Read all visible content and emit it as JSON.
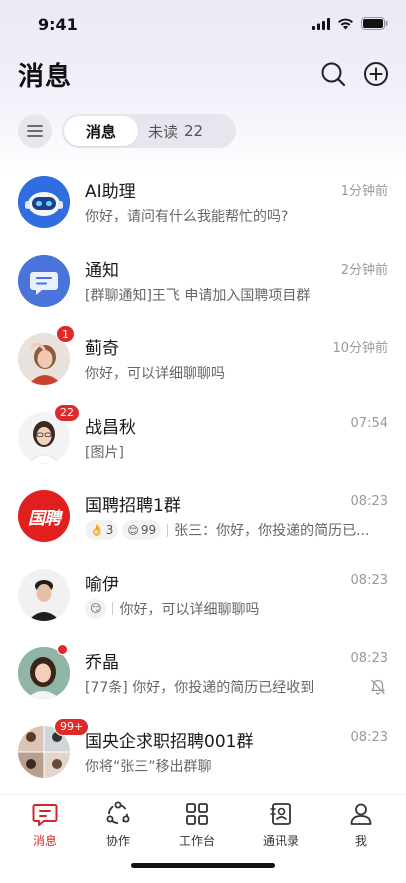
{
  "status": {
    "time": "9:41"
  },
  "header": {
    "title": "消息",
    "search_icon": "search-icon",
    "add_icon": "plus-circle-icon"
  },
  "tabs": {
    "active": "消息",
    "other_label": "未读",
    "other_count": "22"
  },
  "conversations": [
    {
      "name": "AI助理",
      "time": "1分钟前",
      "preview": "你好，请问有什么我能帮忙的吗?",
      "avatar": "robot-avatar"
    },
    {
      "name": "通知",
      "time": "2分钟前",
      "preview": "[群聊通知]王飞 申请加入国聘项目群",
      "avatar": "notification-avatar"
    },
    {
      "name": "蓟奇",
      "time": "10分钟前",
      "preview": "你好，可以详细聊聊吗",
      "badge": "1",
      "avatar": "person-avatar"
    },
    {
      "name": "战昌秋",
      "time": "07:54",
      "preview": "[图片]",
      "badge": "22",
      "avatar": "person-avatar"
    },
    {
      "name": "国聘招聘1群",
      "time": "08:23",
      "reaction1": "3",
      "reaction2": "99",
      "preview": "张三：你好，你投递的简历已...",
      "avatar": "guopin-logo-avatar",
      "logo_text": "国聘"
    },
    {
      "name": "喻伊",
      "time": "08:23",
      "preview": "你好，可以详细聊聊吗",
      "avatar": "person-avatar"
    },
    {
      "name": "乔晶",
      "time": "08:23",
      "preview": "[77条] 你好，你投递的简历已经收到",
      "avatar": "person-avatar",
      "muted": true
    },
    {
      "name": "国央企求职招聘001群",
      "time": "08:23",
      "preview": "你将“张三”移出群聊",
      "badge": "99+",
      "avatar": "group-avatar"
    }
  ],
  "tabbar": {
    "items": [
      {
        "label": "消息",
        "icon": "message-icon",
        "active": true
      },
      {
        "label": "协作",
        "icon": "collab-icon"
      },
      {
        "label": "工作台",
        "icon": "workbench-icon"
      },
      {
        "label": "通讯录",
        "icon": "contacts-icon"
      },
      {
        "label": "我",
        "icon": "profile-icon"
      }
    ]
  },
  "colors": {
    "accent": "#d0282a",
    "badge": "#e02a2a",
    "ai_blue": "#2f6de0",
    "notice_blue": "#4a74d9"
  }
}
